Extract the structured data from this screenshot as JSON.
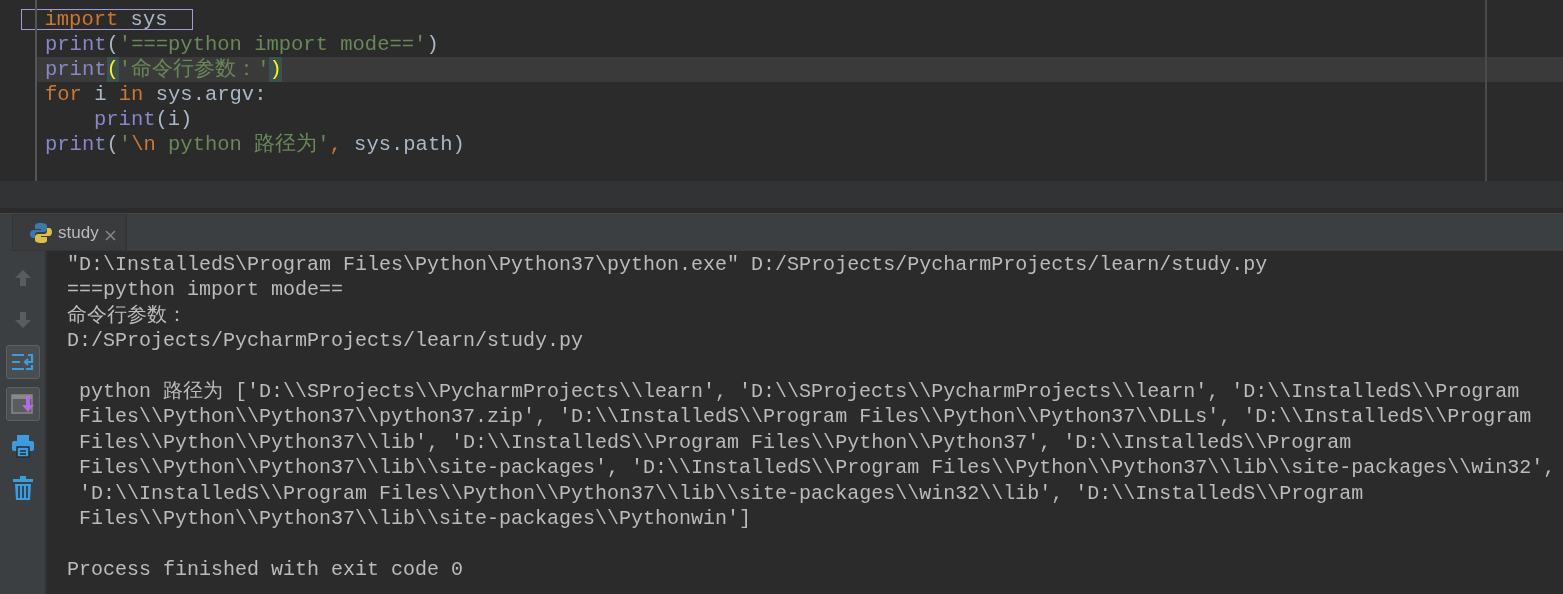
{
  "editor": {
    "lines": [
      {
        "boxed": true,
        "current": false,
        "indented": false,
        "tokens": [
          {
            "kind": "keyword",
            "text": "import"
          },
          {
            "kind": "plain",
            "text": " sys"
          }
        ]
      },
      {
        "boxed": false,
        "current": false,
        "indented": false,
        "tokens": [
          {
            "kind": "builtin",
            "text": "print"
          },
          {
            "kind": "plain",
            "text": "("
          },
          {
            "kind": "string",
            "text": "'===python import mode=='"
          },
          {
            "kind": "plain",
            "text": ")"
          }
        ]
      },
      {
        "boxed": false,
        "current": true,
        "indented": false,
        "tokens": [
          {
            "kind": "builtin",
            "text": "print"
          },
          {
            "kind": "brace",
            "text": "("
          },
          {
            "kind": "string",
            "text": "'命令行参数：'"
          },
          {
            "kind": "brace",
            "text": ")"
          }
        ]
      },
      {
        "boxed": false,
        "current": false,
        "indented": false,
        "tokens": [
          {
            "kind": "keyword",
            "text": "for"
          },
          {
            "kind": "plain",
            "text": " i "
          },
          {
            "kind": "keyword",
            "text": "in"
          },
          {
            "kind": "plain",
            "text": " sys.argv:"
          }
        ]
      },
      {
        "boxed": false,
        "current": false,
        "indented": true,
        "tokens": [
          {
            "kind": "builtin",
            "text": "print"
          },
          {
            "kind": "plain",
            "text": "(i)"
          }
        ]
      },
      {
        "boxed": false,
        "current": false,
        "indented": false,
        "tokens": [
          {
            "kind": "builtin",
            "text": "print"
          },
          {
            "kind": "plain",
            "text": "("
          },
          {
            "kind": "string",
            "text": "'"
          },
          {
            "kind": "keyword",
            "text": "\\n"
          },
          {
            "kind": "string",
            "text": " python 路径为'"
          },
          {
            "kind": "keyword",
            "text": ", "
          },
          {
            "kind": "plain",
            "text": "sys.path)"
          }
        ]
      }
    ]
  },
  "run_tab": {
    "label": "study",
    "selected": true
  },
  "toolbar": [
    {
      "kind": "up",
      "disabled": true,
      "selected": false
    },
    {
      "kind": "down",
      "disabled": true,
      "selected": false
    },
    {
      "kind": "wrap",
      "disabled": false,
      "selected": true
    },
    {
      "kind": "scroll",
      "disabled": false,
      "selected": true
    },
    {
      "kind": "print",
      "disabled": false,
      "selected": false
    },
    {
      "kind": "trash",
      "disabled": false,
      "selected": false
    }
  ],
  "console": {
    "lines": [
      {
        "gap_before": false,
        "text": "\"D:\\InstalledS\\Program Files\\Python\\Python37\\python.exe\" D:/SProjects/PycharmProjects/learn/study.py"
      },
      {
        "gap_before": false,
        "text": "===python import mode=="
      },
      {
        "gap_before": false,
        "text": "命令行参数："
      },
      {
        "gap_before": false,
        "text": "D:/SProjects/PycharmProjects/learn/study.py"
      },
      {
        "gap_before": true,
        "text": " python 路径为 ['D:\\\\SProjects\\\\PycharmProjects\\\\learn', 'D:\\\\SProjects\\\\PycharmProjects\\\\learn', 'D:\\\\InstalledS\\\\Program"
      },
      {
        "gap_before": false,
        "text": " Files\\\\Python\\\\Python37\\\\python37.zip', 'D:\\\\InstalledS\\\\Program Files\\\\Python\\\\Python37\\\\DLLs', 'D:\\\\InstalledS\\\\Program"
      },
      {
        "gap_before": false,
        "text": " Files\\\\Python\\\\Python37\\\\lib', 'D:\\\\InstalledS\\\\Program Files\\\\Python\\\\Python37', 'D:\\\\InstalledS\\\\Program"
      },
      {
        "gap_before": false,
        "text": " Files\\\\Python\\\\Python37\\\\lib\\\\site-packages', 'D:\\\\InstalledS\\\\Program Files\\\\Python\\\\Python37\\\\lib\\\\site-packages\\\\win32',"
      },
      {
        "gap_before": false,
        "text": " 'D:\\\\InstalledS\\\\Program Files\\\\Python\\\\Python37\\\\lib\\\\site-packages\\\\win32\\\\lib', 'D:\\\\InstalledS\\\\Program"
      },
      {
        "gap_before": false,
        "text": " Files\\\\Python\\\\Python37\\\\lib\\\\site-packages\\\\Pythonwin']"
      },
      {
        "gap_before": true,
        "text": "Process finished with exit code 0"
      }
    ]
  }
}
